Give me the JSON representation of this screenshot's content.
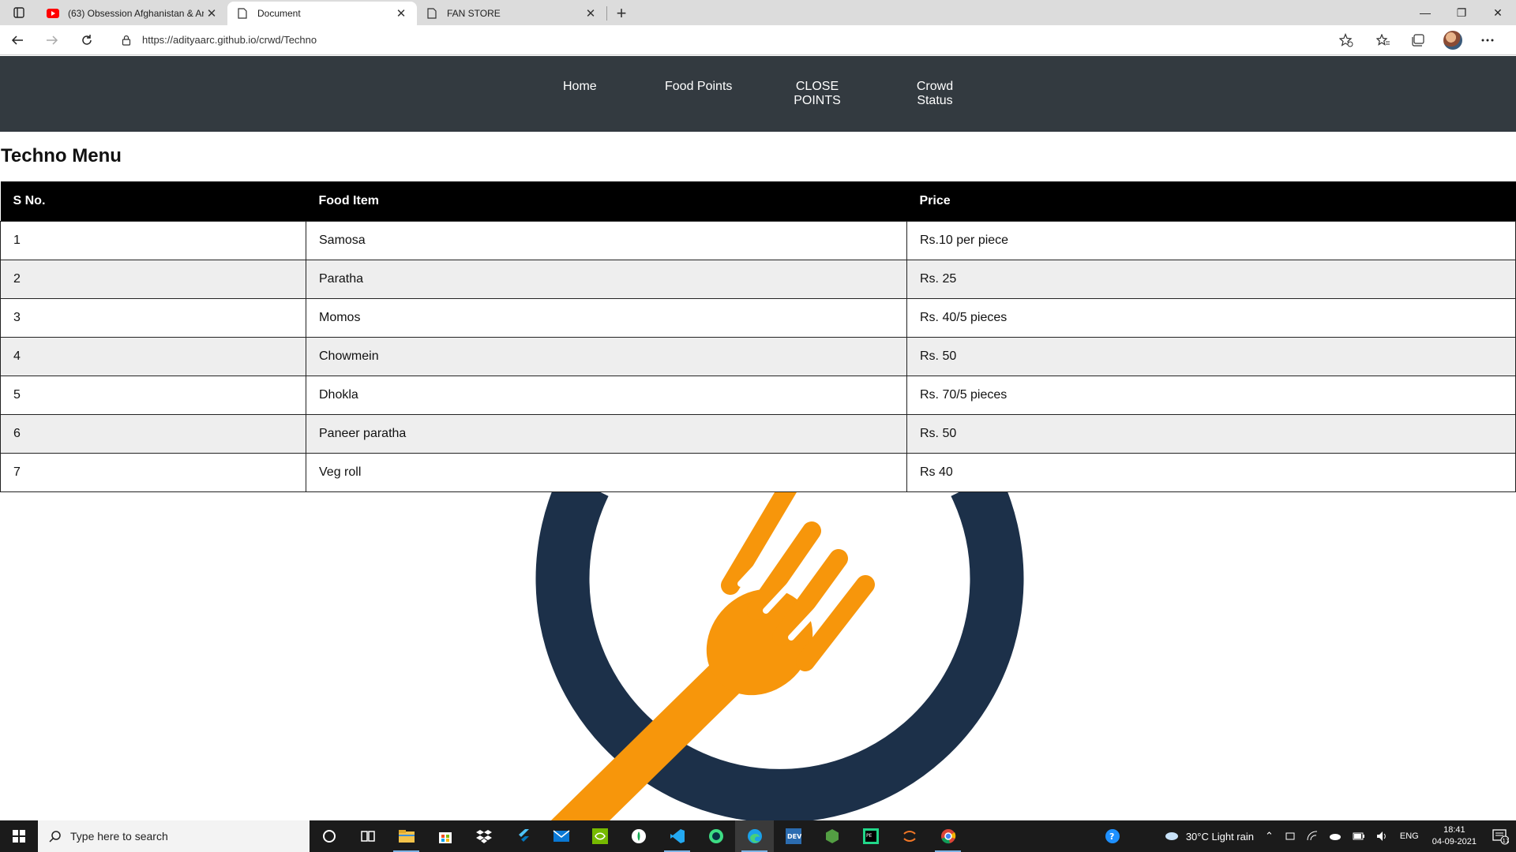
{
  "browser": {
    "tabs": [
      {
        "title": "(63) Obsession Afghanistan & Ar",
        "icon": "youtube-icon",
        "active": false
      },
      {
        "title": "Document",
        "icon": "page-icon",
        "active": true
      },
      {
        "title": "FAN STORE",
        "icon": "page-icon",
        "active": false
      }
    ],
    "url": "https://adityaarc.github.io/crwd/Techno"
  },
  "site_nav": {
    "links": [
      "Home",
      "Food Points",
      "CLOSE POINTS",
      "Crowd Status"
    ]
  },
  "page": {
    "heading": "Techno Menu",
    "table": {
      "headers": [
        "S No.",
        "Food Item",
        "Price"
      ],
      "rows": [
        [
          "1",
          "Samosa",
          "Rs.10 per piece"
        ],
        [
          "2",
          "Paratha",
          "Rs. 25"
        ],
        [
          "3",
          "Momos",
          "Rs. 40/5 pieces"
        ],
        [
          "4",
          "Chowmein",
          "Rs. 50"
        ],
        [
          "5",
          "Dhokla",
          "Rs. 70/5 pieces"
        ],
        [
          "6",
          "Paneer paratha",
          "Rs. 50"
        ],
        [
          "7",
          "Veg roll",
          "Rs 40"
        ]
      ]
    },
    "logo": {
      "ring_color": "#1c3049",
      "fork_color": "#f7960b"
    }
  },
  "taskbar": {
    "search_placeholder": "Type here to search",
    "weather": "30°C  Light rain",
    "language": "ENG",
    "time": "18:41",
    "date": "04-09-2021",
    "notification_count": "11"
  }
}
